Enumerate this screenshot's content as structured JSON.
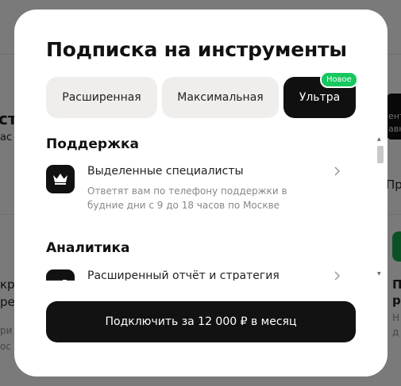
{
  "modal": {
    "title": "Подписка на инструменты",
    "tabs": [
      {
        "label": "Расширенная",
        "active": false
      },
      {
        "label": "Максимальная",
        "active": false
      },
      {
        "label": "Ультра",
        "active": true
      }
    ],
    "badge": "Новое",
    "sections": [
      {
        "title": "Поддержка",
        "items": [
          {
            "title": "Выделенные специалисты",
            "description": "Ответят вам по телефону поддержки в будние дни с 9 до 18 часов по Москве",
            "icon": "crown-icon"
          }
        ]
      },
      {
        "title": "Аналитика",
        "items": [
          {
            "title": "Расширенный отчёт и стратегия",
            "icon": "chart-icon"
          }
        ]
      }
    ],
    "cta": "Подключить за 12 000 ₽ в месяц"
  },
  "background": {
    "left_fragments": [
      "ст",
      "ас",
      "Пр",
      "кр",
      "ре",
      "ри",
      "ос"
    ],
    "right_fragments": [
      "ент",
      "авн",
      "П",
      "р",
      "Н",
      "д"
    ]
  },
  "colors": {
    "accent_dark": "#121212",
    "badge_green": "#17c760",
    "tab_bg": "#f0eeec"
  }
}
